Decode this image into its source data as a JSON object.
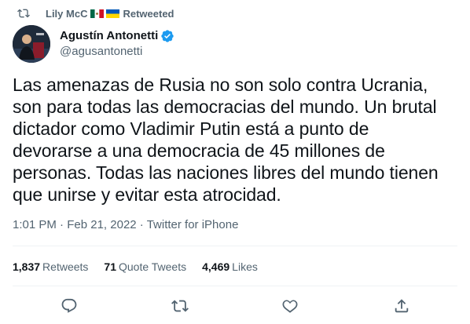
{
  "retweet_bar": {
    "name": "Lily McC",
    "suffix": "Retweeted"
  },
  "author": {
    "display_name": "Agustín Antonetti",
    "handle": "@agusantonetti"
  },
  "tweet": {
    "lines": [
      "Las amenazas de Rusia no son solo contra Ucrania,",
      "son para todas las democracias del mundo. Un brutal",
      "dictador como Vladimir Putin está a punto de",
      "devorarse a una democracia de 45 millones de",
      "personas. Todas las naciones libres del mundo tienen",
      "que unirse y evitar esta atrocidad."
    ]
  },
  "meta": {
    "time": "1:01 PM",
    "separator": "·",
    "date": "Feb 21, 2022",
    "source": "Twitter for iPhone"
  },
  "stats": {
    "retweets_count": "1,837",
    "retweets_label": "Retweets",
    "quotes_count": "71",
    "quotes_label": "Quote Tweets",
    "likes_count": "4,469",
    "likes_label": "Likes"
  },
  "icons": {
    "retweet_header": "retweet-icon",
    "verified": "verified-badge-icon",
    "reply": "reply-icon",
    "retweet": "retweet-icon",
    "like": "heart-icon",
    "share": "share-icon"
  },
  "colors": {
    "text_primary": "#0f1419",
    "text_secondary": "#536471",
    "verified_blue": "#1d9bf0",
    "divider": "#eff3f4"
  }
}
